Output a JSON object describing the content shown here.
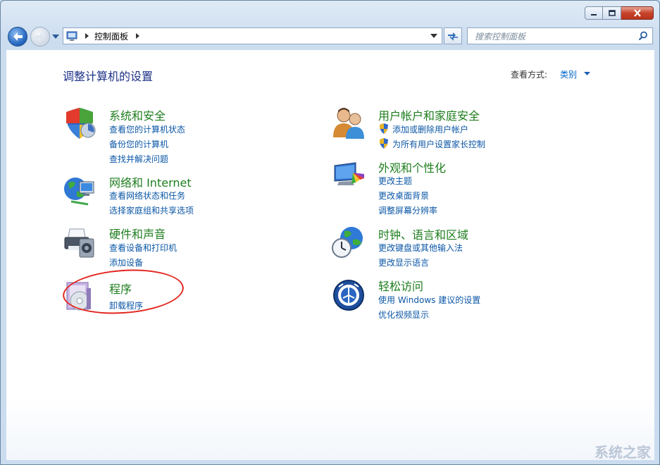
{
  "window": {
    "controls": {
      "minimize": "min",
      "maximize": "max",
      "close": "close"
    }
  },
  "nav": {
    "breadcrumb": "控制面板",
    "search_placeholder": "搜索控制面板"
  },
  "page": {
    "title": "调整计算机的设置",
    "view_by_label": "查看方式:",
    "view_by_value": "类别"
  },
  "categories": [
    {
      "title": "系统和安全",
      "links": [
        "查看您的计算机状态",
        "备份您的计算机",
        "查找并解决问题"
      ],
      "icon": "shield-icon"
    },
    {
      "title": "网络和 Internet",
      "links": [
        "查看网络状态和任务",
        "选择家庭组和共享选项"
      ],
      "icon": "network-globe-icon"
    },
    {
      "title": "硬件和声音",
      "links": [
        "查看设备和打印机",
        "添加设备"
      ],
      "icon": "printer-icon"
    },
    {
      "title": "程序",
      "links": [
        "卸载程序"
      ],
      "icon": "programs-icon"
    },
    {
      "title": "用户帐户和家庭安全",
      "links": [
        "添加或删除用户帐户",
        "为所有用户设置家长控制"
      ],
      "icon": "users-icon"
    },
    {
      "title": "外观和个性化",
      "links": [
        "更改主题",
        "更改桌面背景",
        "调整屏幕分辨率"
      ],
      "icon": "monitor-palette-icon"
    },
    {
      "title": "时钟、语言和区域",
      "links": [
        "更改键盘或其他输入法",
        "更改显示语言"
      ],
      "icon": "clock-globe-icon"
    },
    {
      "title": "轻松访问",
      "links": [
        "使用 Windows 建议的设置",
        "优化视频显示"
      ],
      "icon": "ease-of-access-icon"
    }
  ],
  "watermark": "系统之家",
  "colors": {
    "link": "#0b57a6",
    "category_title": "#1e7d1e",
    "page_title": "#1e3287",
    "annotation": "#e3261f"
  }
}
